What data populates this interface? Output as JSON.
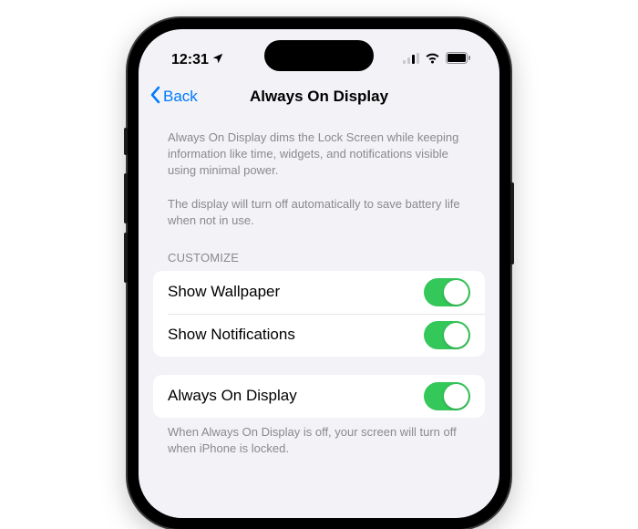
{
  "status": {
    "time": "12:31",
    "location_icon": "➤"
  },
  "nav": {
    "back_label": "Back",
    "title": "Always On Display"
  },
  "description": {
    "line1": "Always On Display dims the Lock Screen while keeping information like time, widgets, and notifications visible using minimal power.",
    "line2": "The display will turn off automatically to save battery life when not in use."
  },
  "customize": {
    "header": "CUSTOMIZE",
    "rows": [
      {
        "label": "Show Wallpaper",
        "on": true
      },
      {
        "label": "Show Notifications",
        "on": true
      }
    ]
  },
  "main_toggle": {
    "label": "Always On Display",
    "on": true,
    "footer": "When Always On Display is off, your screen will turn off when iPhone is locked."
  },
  "colors": {
    "accent": "#007aff",
    "toggle_on": "#34c759",
    "bg": "#f2f2f7"
  }
}
